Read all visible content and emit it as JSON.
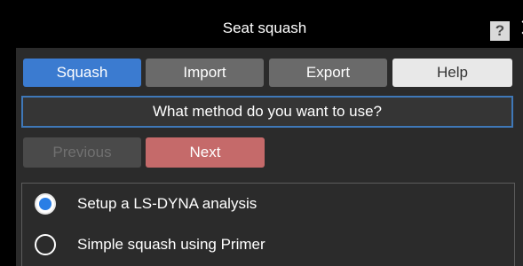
{
  "window": {
    "title": "Seat squash",
    "help_icon": "?",
    "close_icon": "✕"
  },
  "tabs": [
    {
      "label": "Squash",
      "active": true
    },
    {
      "label": "Import",
      "active": false
    },
    {
      "label": "Export",
      "active": false
    },
    {
      "label": "Help",
      "active": false
    }
  ],
  "question": "What method do you want to use?",
  "nav": {
    "previous_label": "Previous",
    "previous_enabled": false,
    "next_label": "Next"
  },
  "options": [
    {
      "label": "Setup a LS-DYNA analysis",
      "selected": true
    },
    {
      "label": "Simple squash using Primer",
      "selected": false
    }
  ],
  "colors": {
    "active_tab": "#3b7bd0",
    "inactive_tab": "#6a6a6a",
    "help_tab": "#e8e8e8",
    "next_button": "#c56a6a",
    "question_border": "#3f78b8",
    "radio_selected": "#2a7ee5"
  }
}
